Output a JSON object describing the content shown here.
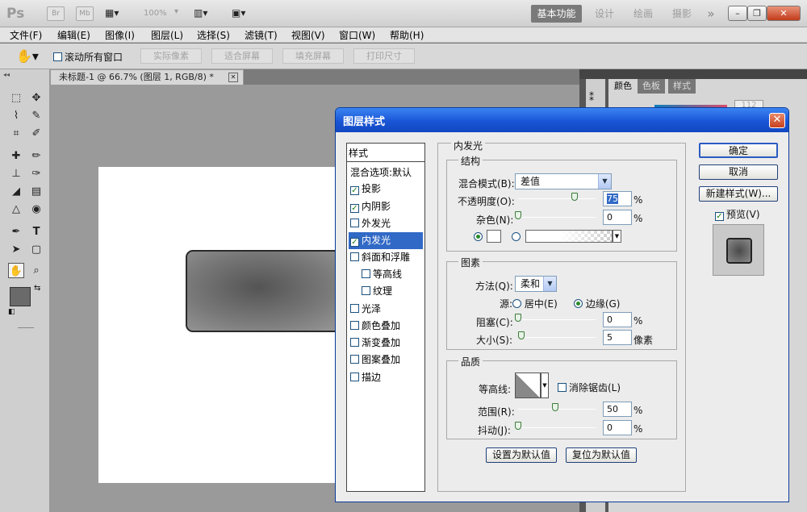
{
  "app": {
    "logo": "Ps",
    "br": "Br",
    "mb": "Mb",
    "zoom": "100%"
  },
  "workspaces": [
    "基本功能",
    "设计",
    "绘画",
    "摄影",
    "»"
  ],
  "window_buttons": [
    "–",
    "❐",
    "✕"
  ],
  "menu": [
    "文件(F)",
    "编辑(E)",
    "图像(I)",
    "图层(L)",
    "选择(S)",
    "滤镜(T)",
    "视图(V)",
    "窗口(W)",
    "帮助(H)"
  ],
  "options": {
    "scroll_all": "滚动所有窗口",
    "buttons": [
      "实际像素",
      "适合屏幕",
      "填充屏幕",
      "打印尺寸"
    ]
  },
  "document": {
    "tab": "未标题-1 @ 66.7% (图层 1, RGB/8) *",
    "close": "✕"
  },
  "right_panel": {
    "tabs": [
      "颜色",
      "色板",
      "样式"
    ],
    "value": "112"
  },
  "dialog": {
    "title": "图层样式",
    "close": "✕",
    "list": [
      {
        "label": "样式",
        "checkbox": false,
        "checked": false,
        "selected": false,
        "indent": false
      },
      {
        "label": "混合选项:默认",
        "checkbox": false,
        "checked": false,
        "selected": false,
        "indent": false
      },
      {
        "label": "投影",
        "checkbox": true,
        "checked": true,
        "selected": false,
        "indent": false
      },
      {
        "label": "内阴影",
        "checkbox": true,
        "checked": true,
        "selected": false,
        "indent": false
      },
      {
        "label": "外发光",
        "checkbox": true,
        "checked": false,
        "selected": false,
        "indent": false
      },
      {
        "label": "内发光",
        "checkbox": true,
        "checked": true,
        "selected": true,
        "indent": false
      },
      {
        "label": "斜面和浮雕",
        "checkbox": true,
        "checked": false,
        "selected": false,
        "indent": false
      },
      {
        "label": "等高线",
        "checkbox": true,
        "checked": false,
        "selected": false,
        "indent": true
      },
      {
        "label": "纹理",
        "checkbox": true,
        "checked": false,
        "selected": false,
        "indent": true
      },
      {
        "label": "光泽",
        "checkbox": true,
        "checked": false,
        "selected": false,
        "indent": false
      },
      {
        "label": "颜色叠加",
        "checkbox": true,
        "checked": false,
        "selected": false,
        "indent": false
      },
      {
        "label": "渐变叠加",
        "checkbox": true,
        "checked": false,
        "selected": false,
        "indent": false
      },
      {
        "label": "图案叠加",
        "checkbox": true,
        "checked": false,
        "selected": false,
        "indent": false
      },
      {
        "label": "描边",
        "checkbox": true,
        "checked": false,
        "selected": false,
        "indent": false
      }
    ],
    "section_title": "内发光",
    "structure": {
      "title": "结构",
      "blend_mode_label": "混合模式(B):",
      "blend_mode": "差值",
      "opacity_label": "不透明度(O):",
      "opacity": "75",
      "noise_label": "杂色(N):",
      "noise": "0",
      "percent": "%"
    },
    "elements": {
      "title": "图素",
      "method_label": "方法(Q):",
      "method": "柔和",
      "source_label": "源:",
      "source_center": "居中(E)",
      "source_edge": "边缘(G)",
      "choke_label": "阻塞(C):",
      "choke": "0",
      "size_label": "大小(S):",
      "size": "5",
      "px": "像素"
    },
    "quality": {
      "title": "品质",
      "contour_label": "等高线:",
      "antialias": "消除锯齿(L)",
      "range_label": "范围(R):",
      "range": "50",
      "jitter_label": "抖动(J):",
      "jitter": "0"
    },
    "make_default": "设置为默认值",
    "reset_default": "复位为默认值",
    "ok": "确定",
    "cancel": "取消",
    "new_style": "新建样式(W)...",
    "preview": "预览(V)"
  }
}
